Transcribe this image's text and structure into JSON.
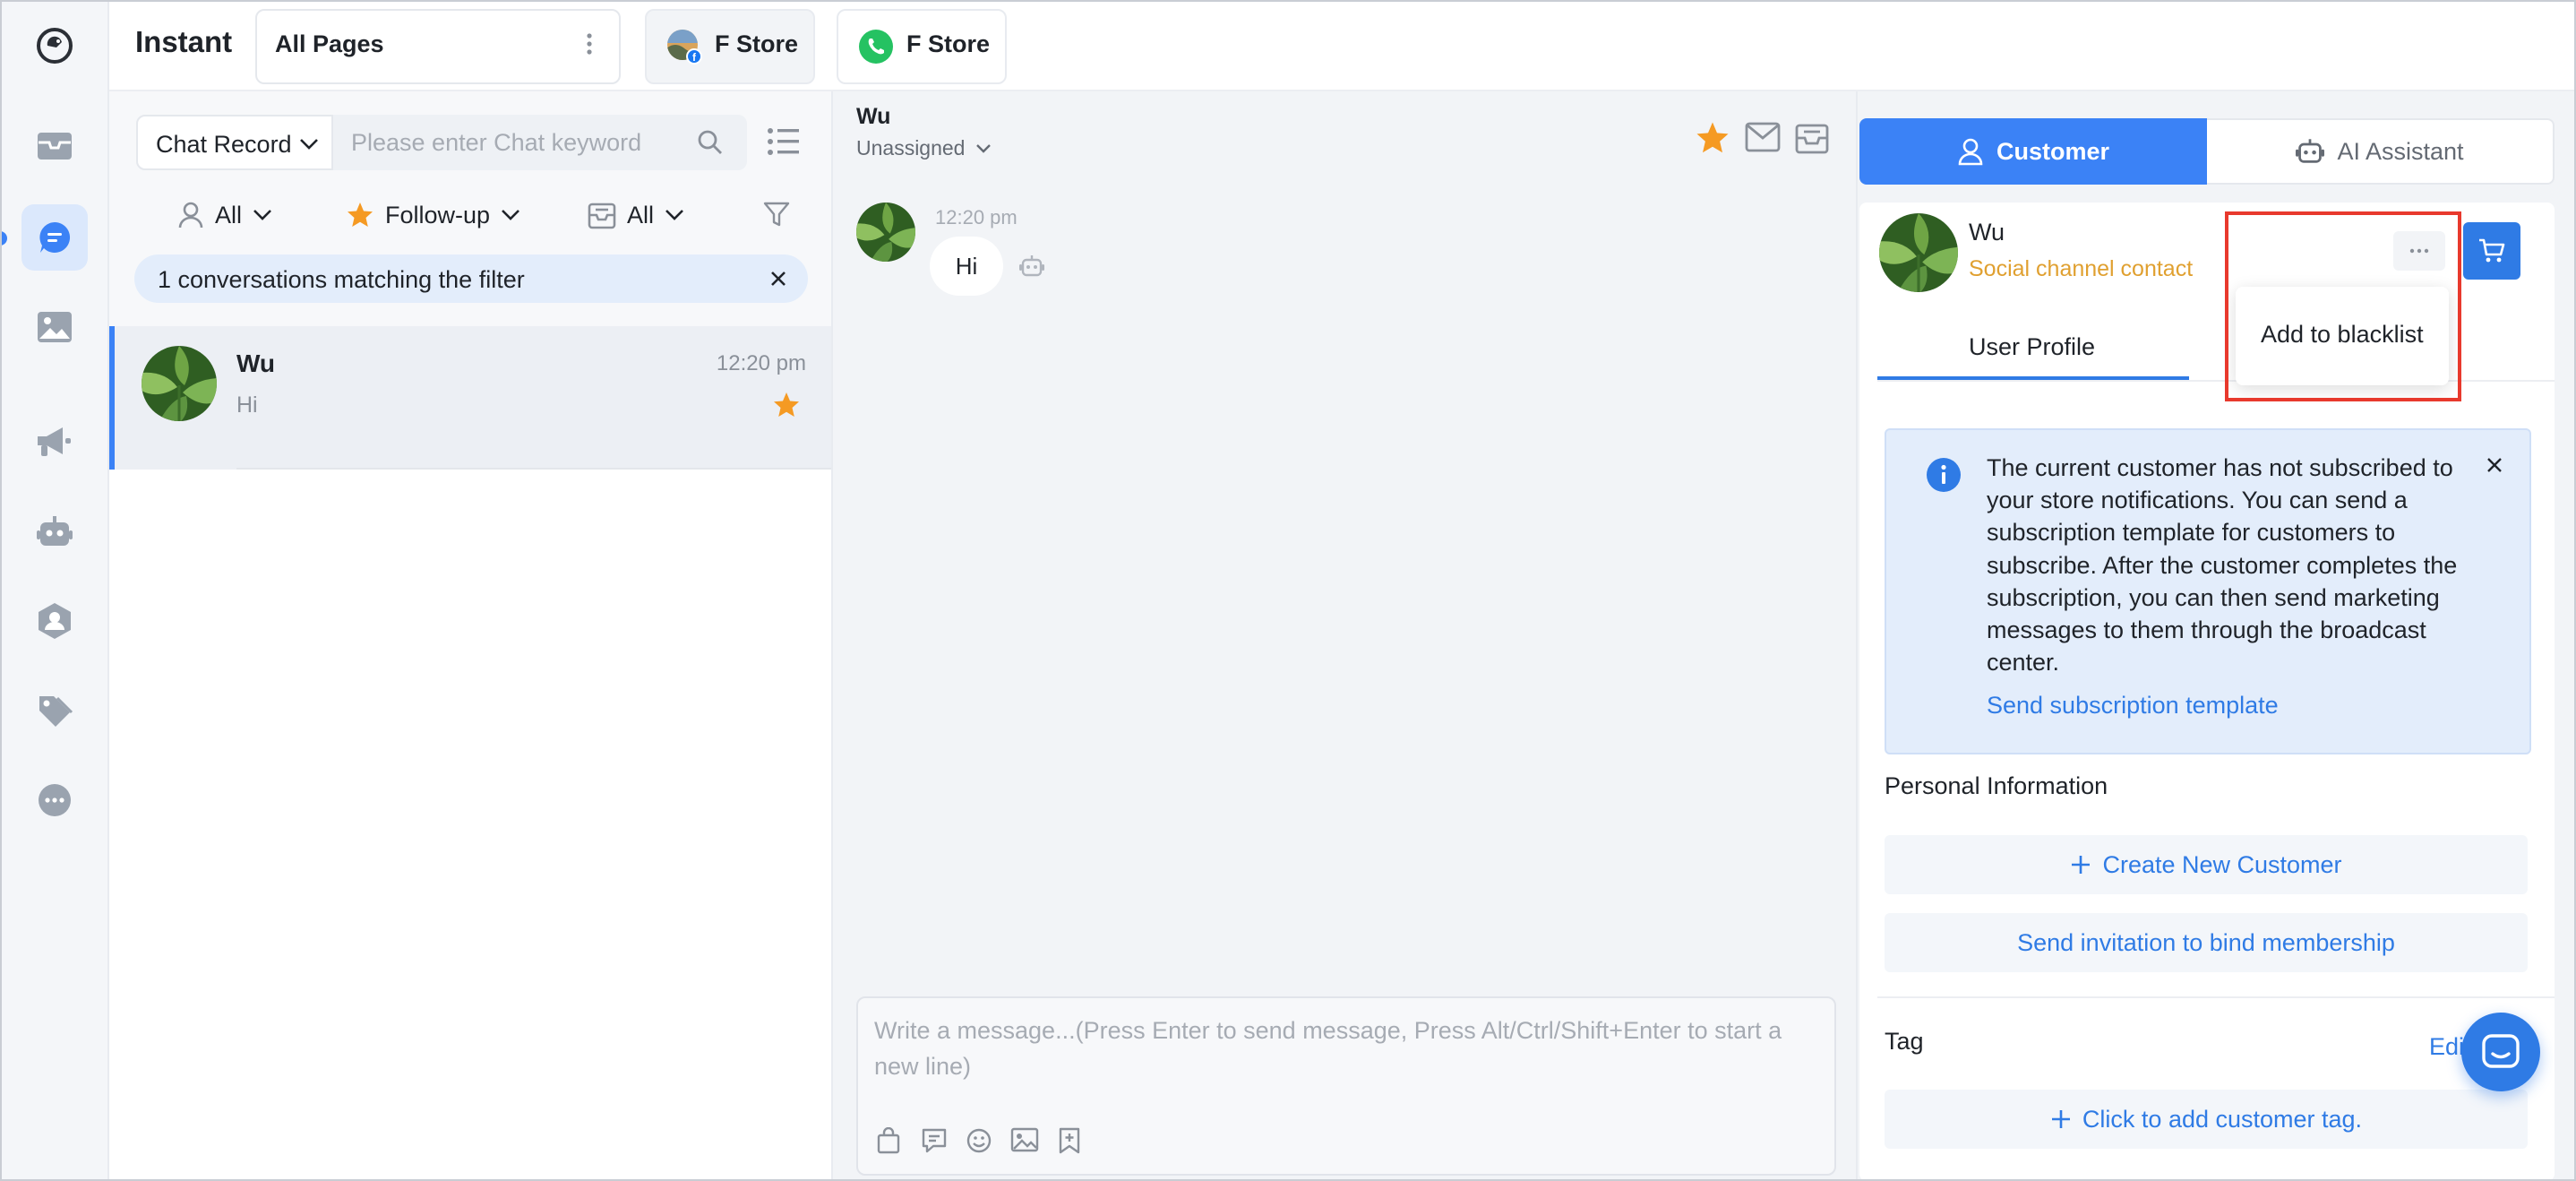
{
  "app": {
    "title": "Instant"
  },
  "topbar": {
    "page_select": "All Pages",
    "store_tabs": [
      {
        "label": "F Store",
        "channel": "facebook"
      },
      {
        "label": "F Store",
        "channel": "whatsapp"
      }
    ]
  },
  "rail": {
    "items": [
      "logo-icon",
      "mail-icon",
      "chat-icon",
      "image-icon",
      "megaphone-icon",
      "robot-icon",
      "contact-icon",
      "tag-icon",
      "more-icon"
    ],
    "active": "chat-icon"
  },
  "list": {
    "search_type": "Chat Record",
    "search_placeholder": "Please enter Chat keyword",
    "filters": {
      "assignee": "All",
      "status": "Follow-up",
      "inbox": "All"
    },
    "match_text": "1 conversations matching the filter",
    "conversations": [
      {
        "name": "Wu",
        "time": "12:20 pm",
        "preview": "Hi",
        "starred": true
      }
    ]
  },
  "chat": {
    "contact_name": "Wu",
    "assignment": "Unassigned",
    "messages": [
      {
        "time": "12:20 pm",
        "text": "Hi"
      }
    ],
    "composer_placeholder": "Write a message...(Press Enter to send message, Press Alt/Ctrl/Shift+Enter to start a new line)"
  },
  "customer": {
    "tabs": {
      "customer": "Customer",
      "ai": "AI Assistant"
    },
    "name": "Wu",
    "contact_type": "Social channel contact",
    "profile_tab": "User Profile",
    "menu_item": "Add to blacklist",
    "notice": "The current customer has not subscribed to your store notifications. You can send a subscription template for customers to subscribe. After the customer completes the subscription, you can then send marketing messages to them through the broadcast center.",
    "notice_link": "Send subscription template",
    "personal_info_label": "Personal Information",
    "create_customer": "Create New Customer",
    "send_invitation": "Send invitation to bind membership",
    "tag_label": "Tag",
    "edit": "Edit",
    "add_tag": "Click to add customer tag."
  },
  "colors": {
    "accent": "#3b82f6",
    "link": "#2f7be5",
    "star": "#f59a23",
    "contact_type": "#e0a030",
    "highlight": "#e8392d"
  }
}
